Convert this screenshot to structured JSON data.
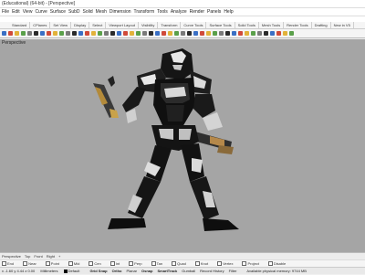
{
  "titlebar": {
    "text": "(Educational) (64-bit) - [Perspective]"
  },
  "menu": [
    "File",
    "Edit",
    "View",
    "Curve",
    "Surface",
    "SubD",
    "Solid",
    "Mesh",
    "Dimension",
    "Transform",
    "Tools",
    "Analyze",
    "Render",
    "Panels",
    "Help"
  ],
  "tabs": [
    "Standard",
    "CPlanes",
    "Set View",
    "Display",
    "Select",
    "Viewport Layout",
    "Visibility",
    "Transform",
    "Curve Tools",
    "Surface Tools",
    "Solid Tools",
    "Mesh Tools",
    "Render Tools",
    "Drafting",
    "New in V5"
  ],
  "toolbar": {
    "button_count": 46,
    "accent_colors": [
      "#3a6fc4",
      "#d04a3a",
      "#e2b23a",
      "#5aa04a",
      "#7a7a7a",
      "#2a2a2a"
    ]
  },
  "viewport": {
    "label": "Perspective",
    "background": "#a5a5a5"
  },
  "viewport_tabs": [
    "Perspective",
    "Top",
    "Front",
    "Right",
    "+"
  ],
  "osnaps": [
    "End",
    "Near",
    "Point",
    "Mid",
    "Cen",
    "Int",
    "Perp",
    "Tan",
    "Quad",
    "Knot",
    "Vertex",
    "Project",
    "Disable"
  ],
  "status": {
    "coords": "x -1.60  y 4.44  z 0.00",
    "units": "Millimeters",
    "layer": "Default",
    "items": [
      "Grid Snap",
      "Ortho",
      "Planar",
      "Osnap",
      "SmartTrack",
      "Gumball",
      "Record History",
      "Filter"
    ],
    "active": [
      "Grid Snap",
      "Ortho",
      "Osnap",
      "SmartTrack"
    ],
    "memory": "Available physical memory: 9744 MB"
  }
}
